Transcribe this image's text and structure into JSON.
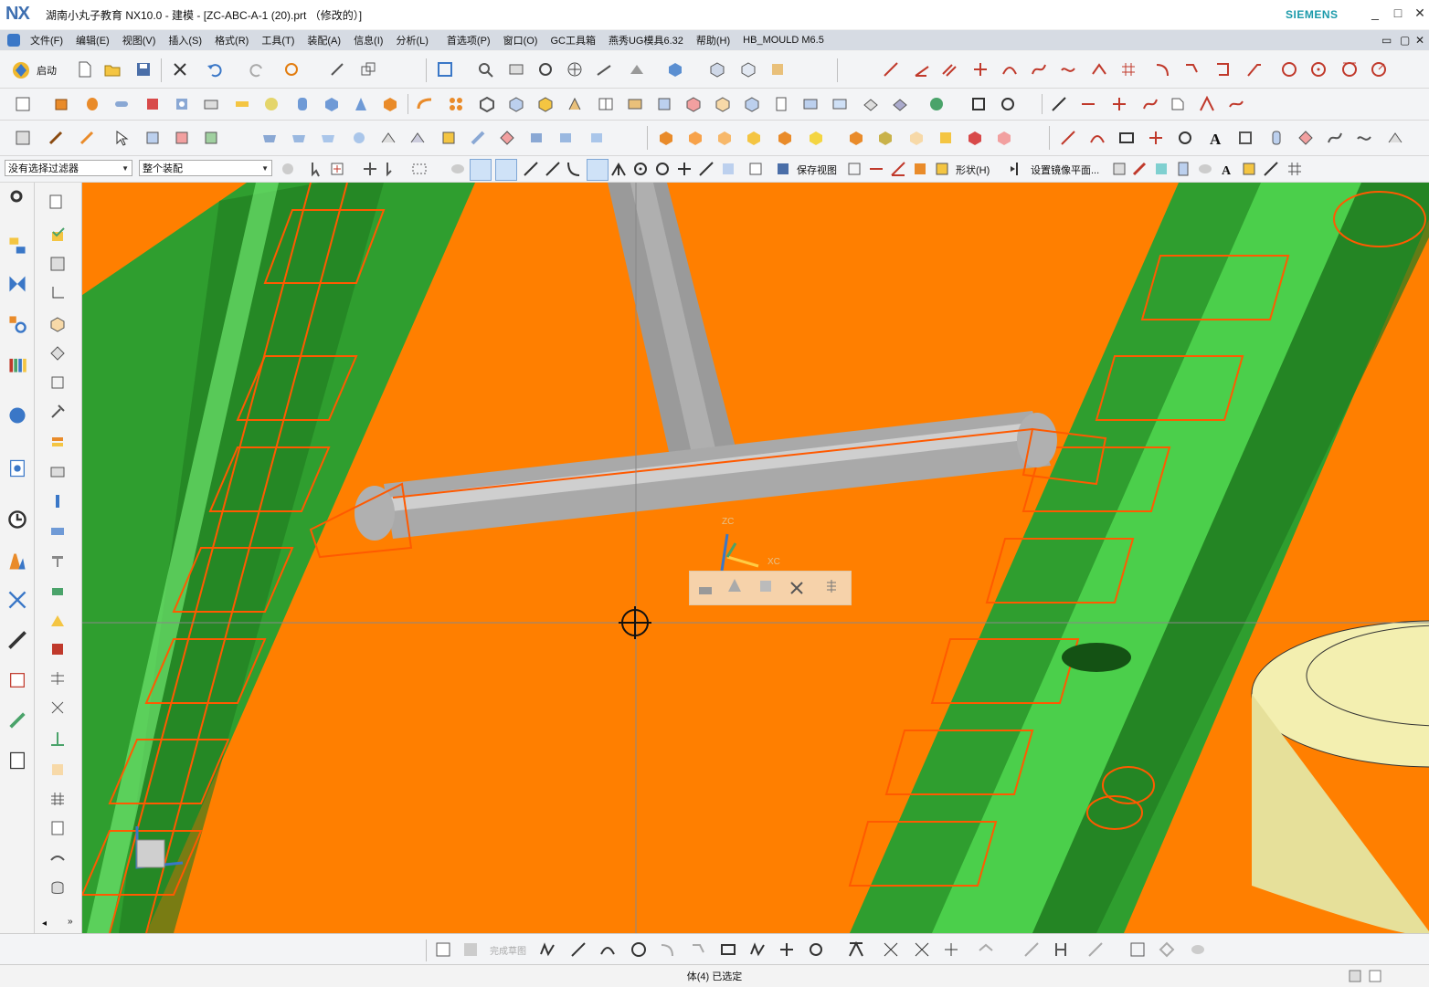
{
  "titlebar": {
    "logo": "NX",
    "title": "湖南小丸子教育 NX10.0 - 建模 - [ZC-ABC-A-1 (20).prt （修改的）]",
    "brand": "SIEMENS",
    "minimize": "_",
    "maximize": "□",
    "close": "✕"
  },
  "menubar": {
    "items": [
      "文件(F)",
      "编辑(E)",
      "视图(V)",
      "插入(S)",
      "格式(R)",
      "工具(T)",
      "装配(A)",
      "信息(I)",
      "分析(L)",
      "首选项(P)",
      "窗口(O)",
      "GC工具箱",
      "燕秀UG模具6.32",
      "帮助(H)",
      "HB_MOULD M6.5"
    ],
    "restore": "▭",
    "close": "✕"
  },
  "toolbar1": {
    "start_label": "启动"
  },
  "selectionbar": {
    "filter_value": "没有选择过滤器",
    "scope_value": "整个装配",
    "save_view_label": "保存视图",
    "shape_label": "形状(H)",
    "mirror_plane_label": "设置镜像平面..."
  },
  "viewport": {
    "zc_label": "ZC",
    "xc_label": "XC",
    "colors": {
      "background": "#ff7f00",
      "plate": "#2f9e2f",
      "plate_dark": "#1f7a1f",
      "wire": "#ff5a00",
      "rod": "#9a9a9a",
      "knob": "#f3efb0"
    }
  },
  "bottombar": {
    "faded_label": "完成草图"
  },
  "statusbar": {
    "text": "体(4) 已选定"
  }
}
